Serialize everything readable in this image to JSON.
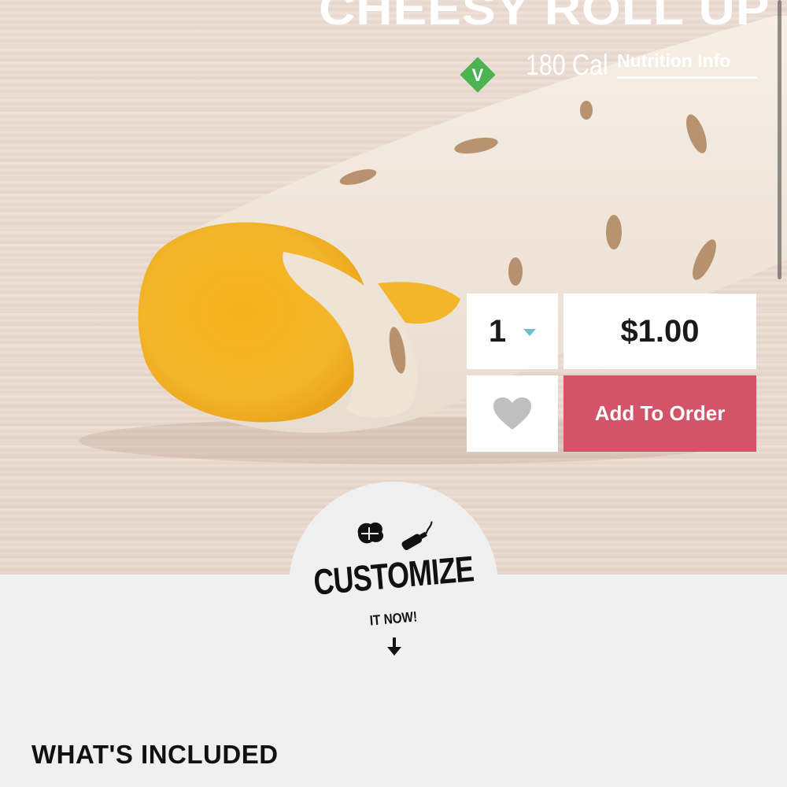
{
  "product": {
    "title": "CHEESY ROLL UP",
    "badge_letter": "V",
    "calories": "180 Cal",
    "nutrition_link": "Nutrition Info"
  },
  "order": {
    "quantity": "1",
    "price": "$1.00",
    "add_label": "Add To Order"
  },
  "customize": {
    "title": "CUSTOMIZE",
    "subtitle": "IT NOW!"
  },
  "section": {
    "whats_included": "WHAT'S INCLUDED"
  },
  "colors": {
    "accent": "#d35369",
    "veg_badge": "#4bb34f",
    "caret": "#6cc1c7",
    "heart": "#bfbfbf"
  },
  "icons": [
    "vegetarian-badge-icon",
    "chevron-down-icon",
    "heart-icon",
    "lettuce-icon",
    "sauce-bottle-icon",
    "arrow-down-icon"
  ]
}
